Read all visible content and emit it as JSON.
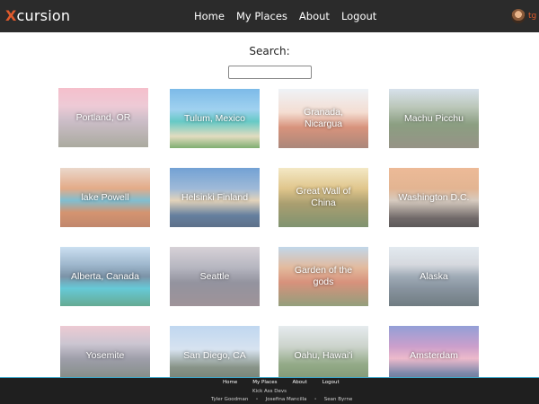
{
  "navbar": {
    "brand_x": "X",
    "brand_rest": "cursion",
    "links": [
      "Home",
      "My Places",
      "About",
      "Logout"
    ],
    "user_initials": "tg"
  },
  "search": {
    "label": "Search:",
    "value": "",
    "placeholder": ""
  },
  "destinations": [
    {
      "label": "Portland, OR"
    },
    {
      "label": "Tulum, Mexico"
    },
    {
      "label": "Granada, Nicargua"
    },
    {
      "label": "Machu Picchu"
    },
    {
      "label": "lake Powell"
    },
    {
      "label": "Helsinki Finland"
    },
    {
      "label": "Great Wall of China"
    },
    {
      "label": "Washington D.C."
    },
    {
      "label": "Alberta, Canada"
    },
    {
      "label": "Seattle"
    },
    {
      "label": "Garden of the gods"
    },
    {
      "label": "Alaska"
    },
    {
      "label": "Yosemite"
    },
    {
      "label": "San Diego, CA"
    },
    {
      "label": "Oahu, Hawai'i"
    },
    {
      "label": "Amsterdam"
    }
  ],
  "footer": {
    "links": [
      "Home",
      "My Places",
      "About",
      "Logout"
    ],
    "team": "Kick Ass Devs",
    "names": [
      "Tyler Goodman",
      "Josefina Mancilla",
      "Sean Byrne"
    ],
    "accent": "#3fa7c9"
  },
  "colors": {
    "navbar_bg": "#2b2b2b",
    "brand_accent": "#e05a2c"
  }
}
